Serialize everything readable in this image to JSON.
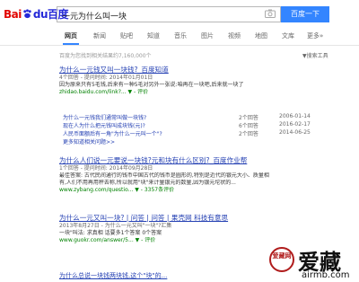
{
  "logo": {
    "bai": "Bai",
    "du": "du",
    "brand": "百度"
  },
  "search": {
    "query": "一元为什么叫一块",
    "button": "百度一下"
  },
  "tabs": [
    "网页",
    "新闻",
    "贴吧",
    "知道",
    "音乐",
    "图片",
    "视频",
    "地图",
    "文库",
    "更多»"
  ],
  "meta": {
    "count_text": "百度为您找到相关结果约7,160,000个",
    "tools": "搜索工具"
  },
  "results": [
    {
      "title": "为什么一元钱又叫一块钱?_百度知道",
      "line1": "4个回答 - 提问时间: 2014年01月01日",
      "line2": "因为原来只有5毛钱,后来有一种5毛对另外一张说:咱再在一块吧,后来就一块了",
      "url": "zhidao.baidu.com/link?... ▼ - 评价",
      "subs": [
        {
          "t": "为什么一元钱我们通常叫做一块钱?",
          "c": "2个回答",
          "d": "2006-01-14"
        },
        {
          "t": "现在人为什么把元钱叫成块钱(元)?",
          "c": "6个回答",
          "d": "2016-02-17"
        },
        {
          "t": "人民币面额后有一角\"为什么一元叫一个\"?",
          "c": "2个回答",
          "d": "2014-06-25"
        }
      ],
      "more": "更多知道相关问题>>"
    },
    {
      "title": "为什么人们说一元要说一块钱?元和块有什么区别?_百度作业帮",
      "line1": "1个回答 - 提问时间: 2014年09月28日",
      "line2": "最佳答案: 古代民间通行的钱币中国古代的钱币是圆形的,特别是近代的银元大小、质量相",
      "line3": "有,人们不用再用秤去称,所以就用\"块\"来计量银元的数量,因为银元坨状的...",
      "url": "www.zybang.com/questio... ▼ - 3357条评价"
    },
    {
      "title": "为什么一元又叫一块? | 问答 | 问答 | 果壳网 科技有意思",
      "line1": "2013年8月27日 - 为什么一元又叫\"一块\"?汇集",
      "line2": "一块\"叫法: 求真相 话要多1个答案 0个答案",
      "url": "www.guokr.com/answer/5... ▼ - 评价"
    },
    {
      "title": "为什么总说一块钱两块钱,这个\"块\"的..."
    }
  ],
  "watermark": {
    "seal": "爱藏网",
    "big": "爱藏",
    "domain": "airmb.com"
  }
}
